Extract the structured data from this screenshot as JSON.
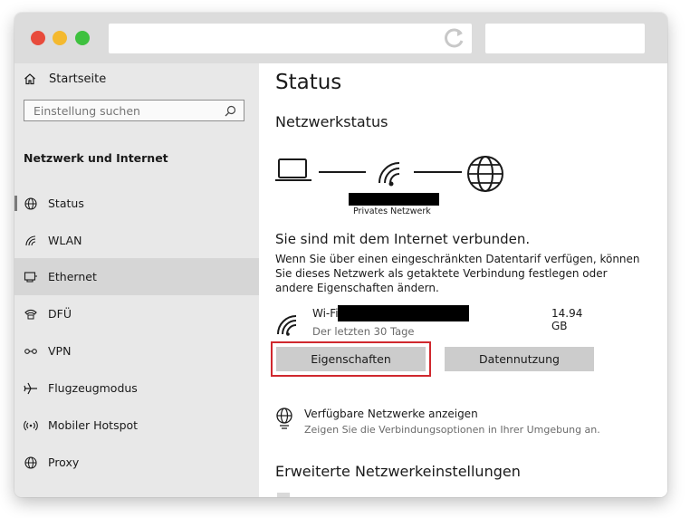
{
  "sidebar": {
    "home_label": "Startseite",
    "search_placeholder": "Einstellung suchen",
    "heading": "Netzwerk und Internet",
    "items": [
      {
        "label": "Status",
        "icon": "globe-icon"
      },
      {
        "label": "WLAN",
        "icon": "wifi-icon"
      },
      {
        "label": "Ethernet",
        "icon": "ethernet-icon",
        "selected": true
      },
      {
        "label": "DFÜ",
        "icon": "phone-icon"
      },
      {
        "label": "VPN",
        "icon": "vpn-icon"
      },
      {
        "label": "Flugzeugmodus",
        "icon": "airplane-icon"
      },
      {
        "label": "Mobiler Hotspot",
        "icon": "hotspot-icon"
      },
      {
        "label": "Proxy",
        "icon": "globe-icon"
      }
    ]
  },
  "main": {
    "title": "Status",
    "section_title": "Netzwerkstatus",
    "network_label": "Privates Netzwerk",
    "connected_text": "Sie sind mit dem Internet verbunden.",
    "description": "Wenn Sie über einen eingeschränkten Datentarif verfügen, können Sie dieses Netzwerk als getaktete Verbindung festlegen oder andere Eigenschaften ändern.",
    "connection": {
      "name": "Wi-Fi",
      "subtitle": "Der letzten 30 Tage",
      "usage": "14.94 GB"
    },
    "buttons": {
      "properties": "Eigenschaften",
      "data_usage": "Datennutzung"
    },
    "available": {
      "title": "Verfügbare Netzwerke anzeigen",
      "subtitle": "Zeigen Sie die Verbindungsoptionen in Ihrer Umgebung an."
    },
    "advanced_title": "Erweiterte Netzwerkeinstellungen"
  },
  "colors": {
    "highlight": "#d0282e",
    "selected_nav": "#d6d6d6",
    "button": "#cccccc"
  }
}
